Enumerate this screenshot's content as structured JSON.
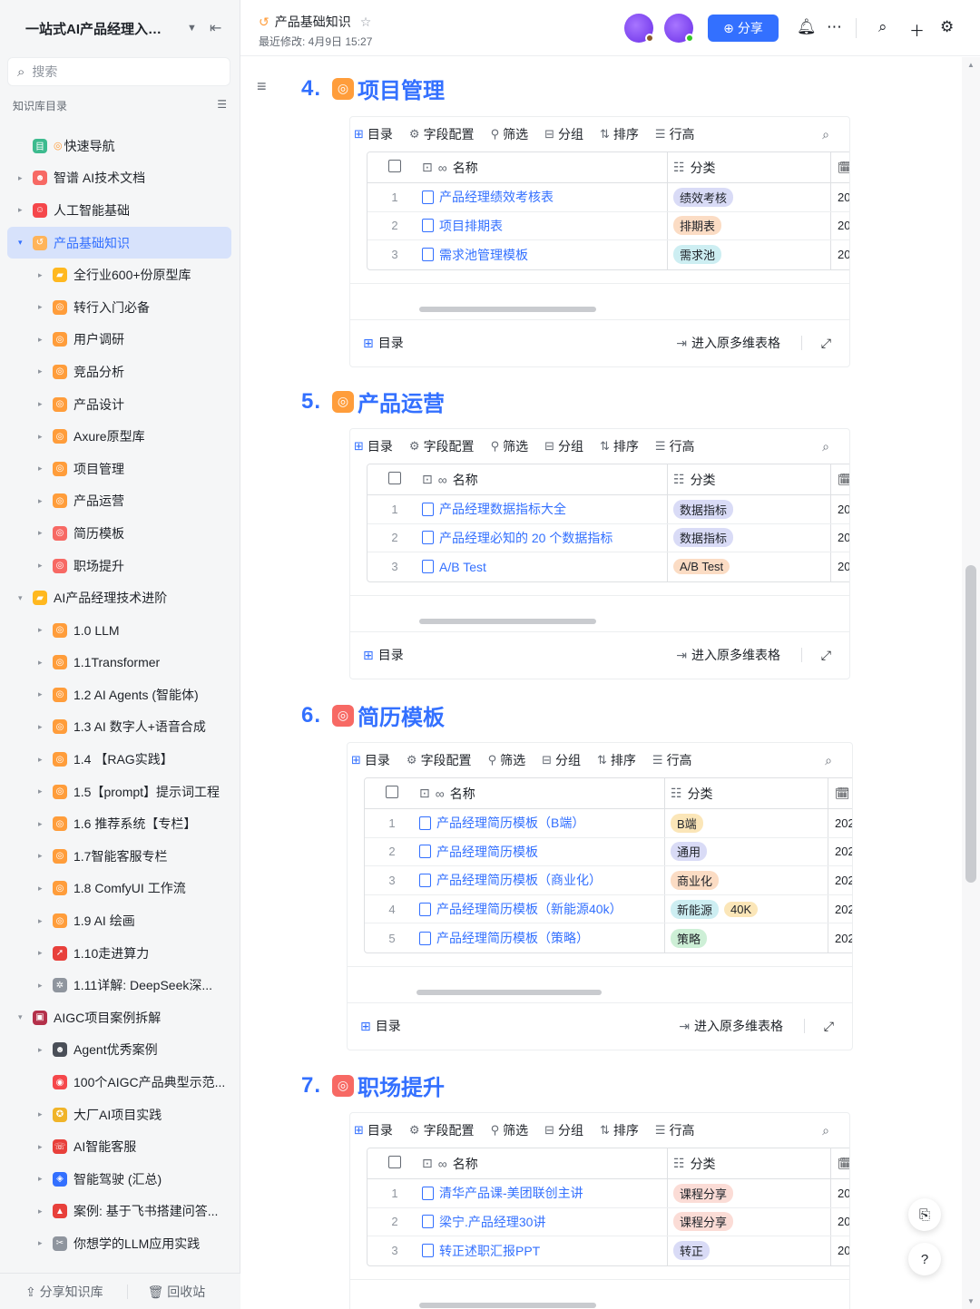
{
  "sidebar": {
    "title": "一站式AI产品经理入门...",
    "search_placeholder": "搜索",
    "section_label": "知识库目录",
    "items": [
      {
        "label": "快速导航",
        "level": 0,
        "arrow": "",
        "icon_color": "#3dbb8f",
        "icon": "目",
        "prefix": "◎"
      },
      {
        "label": "智谱 AI技术文档",
        "level": 0,
        "arrow": "▸",
        "icon_color": "#f76964",
        "icon": "☻"
      },
      {
        "label": "人工智能基础",
        "level": 0,
        "arrow": "▸",
        "icon_color": "#f5474b",
        "icon": "☺"
      },
      {
        "label": "产品基础知识",
        "level": 0,
        "arrow": "▾",
        "icon_color": "#ffb45a",
        "icon": "↺",
        "active": true
      },
      {
        "label": "全行业600+份原型库",
        "level": 1,
        "arrow": "▸",
        "icon_color": "#ffb81f",
        "icon": "▰"
      },
      {
        "label": "转行入门必备",
        "level": 1,
        "arrow": "▸",
        "icon_color": "#ff9d3b",
        "icon": "◎"
      },
      {
        "label": "用户调研",
        "level": 1,
        "arrow": "▸",
        "icon_color": "#ff9d3b",
        "icon": "◎"
      },
      {
        "label": "竞品分析",
        "level": 1,
        "arrow": "▸",
        "icon_color": "#ff9d3b",
        "icon": "◎"
      },
      {
        "label": "产品设计",
        "level": 1,
        "arrow": "▸",
        "icon_color": "#ff9d3b",
        "icon": "◎"
      },
      {
        "label": "Axure原型库",
        "level": 1,
        "arrow": "▸",
        "icon_color": "#ff9d3b",
        "icon": "◎"
      },
      {
        "label": "项目管理",
        "level": 1,
        "arrow": "▸",
        "icon_color": "#ff9d3b",
        "icon": "◎"
      },
      {
        "label": "产品运营",
        "level": 1,
        "arrow": "▸",
        "icon_color": "#ff9d3b",
        "icon": "◎"
      },
      {
        "label": "简历模板",
        "level": 1,
        "arrow": "▸",
        "icon_color": "#f76964",
        "icon": "◎"
      },
      {
        "label": "职场提升",
        "level": 1,
        "arrow": "▸",
        "icon_color": "#f76964",
        "icon": "◎"
      },
      {
        "label": "AI产品经理技术进阶",
        "level": 0,
        "arrow": "▾",
        "icon_color": "#ffb81f",
        "icon": "▰"
      },
      {
        "label": "1.0 LLM",
        "level": 1,
        "arrow": "▸",
        "icon_color": "#ff9d3b",
        "icon": "◎"
      },
      {
        "label": "1.1Transformer",
        "level": 1,
        "arrow": "▸",
        "icon_color": "#ff9d3b",
        "icon": "◎"
      },
      {
        "label": "1.2 AI Agents (智能体)",
        "level": 1,
        "arrow": "▸",
        "icon_color": "#ff9d3b",
        "icon": "◎"
      },
      {
        "label": "1.3 AI 数字人+语音合成",
        "level": 1,
        "arrow": "▸",
        "icon_color": "#ff9d3b",
        "icon": "◎"
      },
      {
        "label": "1.4 【RAG实践】",
        "level": 1,
        "arrow": "▸",
        "icon_color": "#ff9d3b",
        "icon": "◎"
      },
      {
        "label": "1.5【prompt】提示词工程",
        "level": 1,
        "arrow": "▸",
        "icon_color": "#ff9d3b",
        "icon": "◎"
      },
      {
        "label": "1.6 推荐系统【专栏】",
        "level": 1,
        "arrow": "▸",
        "icon_color": "#ff9d3b",
        "icon": "◎"
      },
      {
        "label": "1.7智能客服专栏",
        "level": 1,
        "arrow": "▸",
        "icon_color": "#ff9d3b",
        "icon": "◎"
      },
      {
        "label": "1.8 ComfyUI 工作流",
        "level": 1,
        "arrow": "▸",
        "icon_color": "#ff9d3b",
        "icon": "◎"
      },
      {
        "label": "1.9 AI 绘画",
        "level": 1,
        "arrow": "▸",
        "icon_color": "#ff9d3b",
        "icon": "◎"
      },
      {
        "label": "1.10走进算力",
        "level": 1,
        "arrow": "▸",
        "icon_color": "#e8403b",
        "icon": "➚"
      },
      {
        "label": "1.11详解: DeepSeek深...",
        "level": 1,
        "arrow": "▸",
        "icon_color": "#8f959e",
        "icon": "✲"
      },
      {
        "label": "AIGC项目案例拆解",
        "level": 0,
        "arrow": "▾",
        "icon_color": "#b4304a",
        "icon": "▣"
      },
      {
        "label": "Agent优秀案例",
        "level": 1,
        "arrow": "▸",
        "icon_color": "#4a4f58",
        "icon": "☻"
      },
      {
        "label": "100个AIGC产品典型示范...",
        "level": 1,
        "arrow": "",
        "icon_color": "#f5474b",
        "icon": "◉"
      },
      {
        "label": "大厂AI项目实践",
        "level": 1,
        "arrow": "▸",
        "icon_color": "#f0b429",
        "icon": "✪"
      },
      {
        "label": "AI智能客服",
        "level": 1,
        "arrow": "▸",
        "icon_color": "#e8403b",
        "icon": "☏"
      },
      {
        "label": "智能驾驶 (汇总)",
        "level": 1,
        "arrow": "▸",
        "icon_color": "#3370ff",
        "icon": "◈"
      },
      {
        "label": "案例: 基于飞书搭建问答...",
        "level": 1,
        "arrow": "▸",
        "icon_color": "#e8403b",
        "icon": "▲"
      },
      {
        "label": "你想学的LLM应用实践",
        "level": 1,
        "arrow": "▸",
        "icon_color": "#8f959e",
        "icon": "✂"
      }
    ],
    "footer": {
      "share": "分享知识库",
      "recycle": "回收站"
    }
  },
  "topbar": {
    "title": "产品基础知识",
    "subtitle": "最近修改: 4月9日 15:27",
    "share_label": "分享"
  },
  "toolbar": {
    "catalog": "目录",
    "field_config": "字段配置",
    "filter": "筛选",
    "group": "分组",
    "sort": "排序",
    "row_height": "行高",
    "col_name": "名称",
    "col_category": "分类",
    "footer_catalog": "目录",
    "enter_table": "进入原多维表格"
  },
  "sections": [
    {
      "num": "4.",
      "title": "项目管理",
      "icon_color": "#ff9d3b",
      "rows": [
        {
          "idx": "1",
          "name": "产品经理绩效考核表",
          "tags": [
            {
              "text": "绩效考核",
              "color": "#d9dbf6"
            }
          ],
          "date": "20"
        },
        {
          "idx": "2",
          "name": "项目排期表",
          "tags": [
            {
              "text": "排期表",
              "color": "#fbdcc4"
            }
          ],
          "date": "20"
        },
        {
          "idx": "3",
          "name": "需求池管理模板",
          "tags": [
            {
              "text": "需求池",
              "color": "#cdeef2"
            }
          ],
          "date": "20"
        }
      ]
    },
    {
      "num": "5.",
      "title": "产品运营",
      "icon_color": "#ff9d3b",
      "rows": [
        {
          "idx": "1",
          "name": "产品经理数据指标大全",
          "tags": [
            {
              "text": "数据指标",
              "color": "#d9dbf6"
            }
          ],
          "date": "20"
        },
        {
          "idx": "2",
          "name": "产品经理必知的 20 个数据指标",
          "tags": [
            {
              "text": "数据指标",
              "color": "#d9dbf6"
            }
          ],
          "date": "20"
        },
        {
          "idx": "3",
          "name": "A/B Test",
          "tags": [
            {
              "text": "A/B Test",
              "color": "#fbdcc4"
            }
          ],
          "date": "20"
        }
      ]
    },
    {
      "num": "6.",
      "title": "简历模板",
      "icon_color": "#f76964",
      "rows": [
        {
          "idx": "1",
          "name": "产品经理简历模板（B端）",
          "tags": [
            {
              "text": "B端",
              "color": "#fbe6b8"
            }
          ],
          "date": "202"
        },
        {
          "idx": "2",
          "name": "产品经理简历模板",
          "tags": [
            {
              "text": "通用",
              "color": "#d9dbf6"
            }
          ],
          "date": "202"
        },
        {
          "idx": "3",
          "name": "产品经理简历模板（商业化）",
          "tags": [
            {
              "text": "商业化",
              "color": "#fbdcc4"
            }
          ],
          "date": "202"
        },
        {
          "idx": "4",
          "name": "产品经理简历模板（新能源40k）",
          "tags": [
            {
              "text": "新能源",
              "color": "#cdeef2"
            },
            {
              "text": "40K",
              "color": "#fbe6b8"
            }
          ],
          "date": "202"
        },
        {
          "idx": "5",
          "name": "产品经理简历模板（策略）",
          "tags": [
            {
              "text": "策略",
              "color": "#cdefd6"
            }
          ],
          "date": "202"
        }
      ]
    },
    {
      "num": "7.",
      "title": "职场提升",
      "icon_color": "#f76964",
      "rows": [
        {
          "idx": "1",
          "name": "清华产品课-美团联创主讲",
          "tags": [
            {
              "text": "课程分享",
              "color": "#fbdcd6"
            }
          ],
          "date": "20"
        },
        {
          "idx": "2",
          "name": "梁宁.产品经理30讲",
          "tags": [
            {
              "text": "课程分享",
              "color": "#fbdcd6"
            }
          ],
          "date": "20"
        },
        {
          "idx": "3",
          "name": "转正述职汇报PPT",
          "tags": [
            {
              "text": "转正",
              "color": "#d9dbf6"
            }
          ],
          "date": "20"
        }
      ]
    }
  ]
}
